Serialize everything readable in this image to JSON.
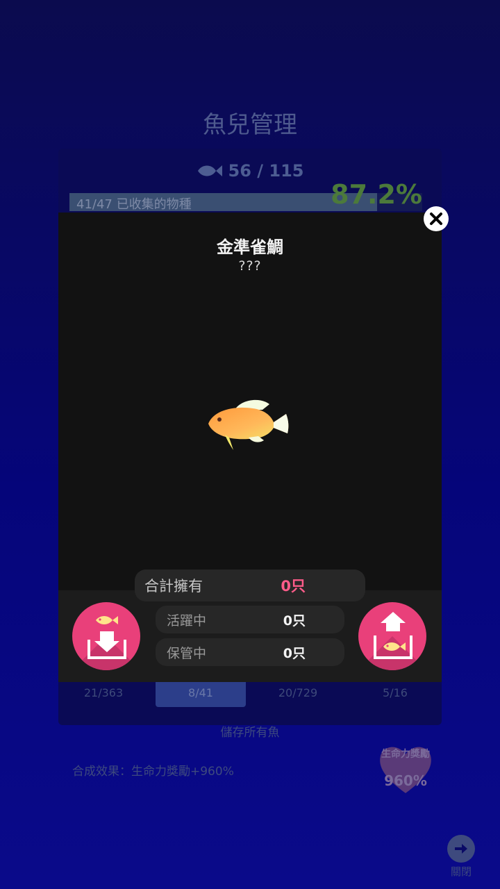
{
  "background": {
    "title": "魚兒管理",
    "fish_count": "56 / 115",
    "progress_label": "41/47 已收集的物種",
    "progress_fraction": 0.8723,
    "percent": "87.2%",
    "tabs": [
      {
        "label": "21/363",
        "active": false
      },
      {
        "label": "8/41",
        "active": true
      },
      {
        "label": "20/729",
        "active": false
      },
      {
        "label": "5/16",
        "active": false
      }
    ],
    "save_all_label": "儲存所有魚",
    "synthesis_effect": "合成效果：生命力獎勵+960%",
    "vitality_badge": {
      "label": "生命力獎勵",
      "value": "960%"
    },
    "close_label": "關閉"
  },
  "modal": {
    "title": "金準雀鯛",
    "subtitle": "???",
    "total_owned_label": "合計擁有",
    "total_owned_value": "0只",
    "active_label": "活躍中",
    "active_value": "0只",
    "stored_label": "保管中",
    "stored_value": "0只"
  },
  "colors": {
    "accent_pink": "#e9407a",
    "total_value": "#ff5c8a",
    "modal_bg": "#121212"
  },
  "icons": {
    "close": "close-x-icon",
    "store": "fish-into-box-icon",
    "release": "fish-out-of-box-icon"
  }
}
